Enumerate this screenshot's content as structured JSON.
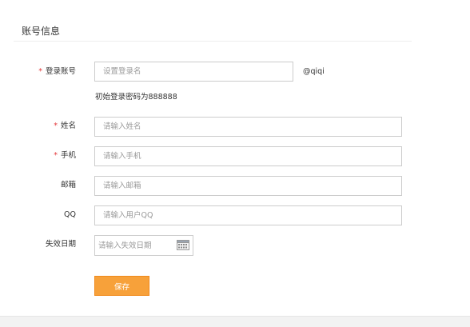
{
  "section": {
    "title": "账号信息"
  },
  "form": {
    "login_account": {
      "label": "登录账号",
      "required_mark": "*",
      "placeholder": "设置登录名",
      "value": "",
      "suffix": "@qiqi",
      "hint": "初始登录密码为888888"
    },
    "name": {
      "label": "姓名",
      "required_mark": "*",
      "placeholder": "请输入姓名",
      "value": ""
    },
    "phone": {
      "label": "手机",
      "required_mark": "*",
      "placeholder": "请输入手机",
      "value": ""
    },
    "email": {
      "label": "邮箱",
      "placeholder": "请输入邮箱",
      "value": ""
    },
    "qq": {
      "label": "QQ",
      "placeholder": "请输入用户QQ",
      "value": ""
    },
    "expiry_date": {
      "label": "失效日期",
      "placeholder": "请输入失效日期",
      "value": "",
      "icon": "calendar-icon"
    },
    "save_label": "保存"
  },
  "colors": {
    "required": "#e4393c",
    "primary_button": "#f7a13a",
    "input_border": "#cccccc",
    "placeholder": "#999999",
    "text": "#333333"
  }
}
